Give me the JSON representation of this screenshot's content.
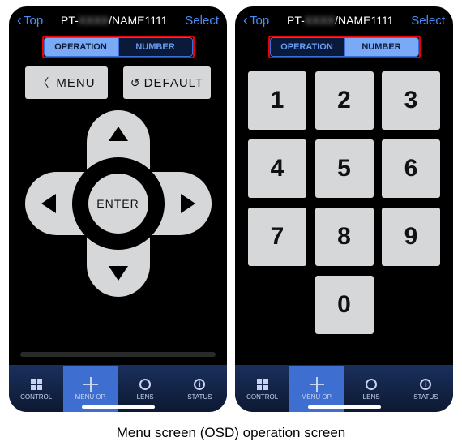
{
  "header": {
    "back_label": "Top",
    "title_prefix": "PT-",
    "title_blur": "XXXX",
    "title_suffix": "/NAME1111",
    "select_label": "Select"
  },
  "tabs": {
    "operation": "OPERATION",
    "number": "NUMBER"
  },
  "buttons": {
    "menu": "MENU",
    "default": "DEFAULT",
    "enter": "ENTER"
  },
  "numpad": [
    [
      "1",
      "2",
      "3"
    ],
    [
      "4",
      "5",
      "6"
    ],
    [
      "7",
      "8",
      "9"
    ],
    [
      "0"
    ]
  ],
  "bottombar": {
    "control": "CONTROL",
    "menuop": "MENU OP.",
    "lens": "LENS",
    "status": "STATUS"
  },
  "caption": "Menu screen (OSD) operation screen"
}
